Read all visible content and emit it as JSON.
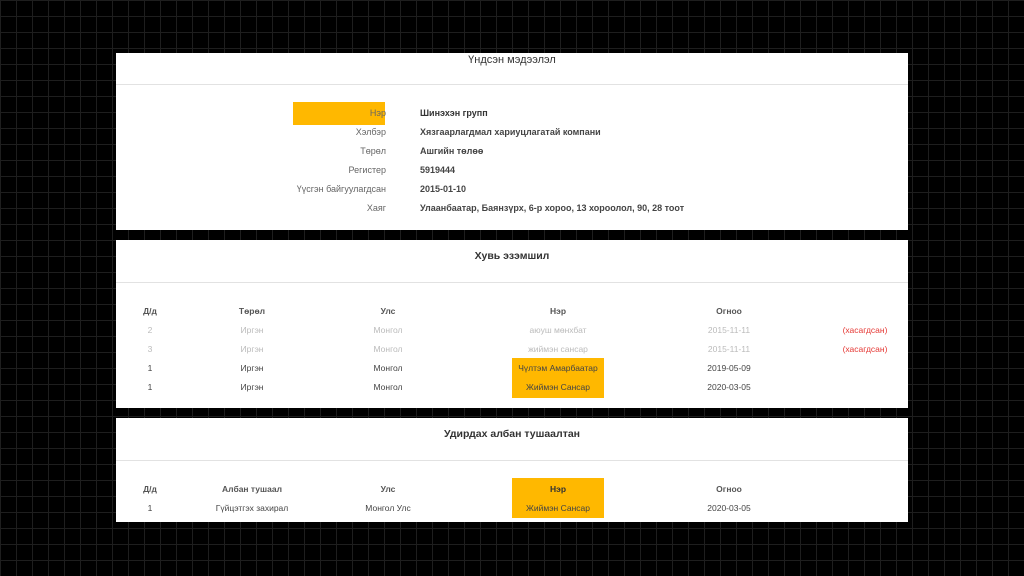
{
  "basic": {
    "title": "Үндсэн мэдээлэл",
    "rows": [
      {
        "label": "Нэр",
        "value": "Шинэхэн групп"
      },
      {
        "label": "Хэлбэр",
        "value": "Хязгаарлагдмал хариуцлагатай компани"
      },
      {
        "label": "Төрөл",
        "value": "Ашгийн төлөө"
      },
      {
        "label": "Регистер",
        "value": "5919444"
      },
      {
        "label": "Үүсгэн байгуулагдсан",
        "value": "2015-01-10"
      },
      {
        "label": "Хаяг",
        "value": "Улаанбаатар, Баянзүрх, 6-р хороо, 13 хороолол, 90, 28 тоот"
      }
    ]
  },
  "ownership": {
    "title": "Хувь эзэмшил",
    "headers": [
      "Д/д",
      "Төрөл",
      "Улс",
      "Нэр",
      "Огноо"
    ],
    "rows": [
      {
        "no": "2",
        "type": "Иргэн",
        "country": "Монгол",
        "name": "аюуш мөнхбат",
        "date": "2015-11-11",
        "status": "(хасагдсан)"
      },
      {
        "no": "3",
        "type": "Иргэн",
        "country": "Монгол",
        "name": "жиймэн сансар",
        "date": "2015-11-11",
        "status": "(хасагдсан)"
      },
      {
        "no": "1",
        "type": "Иргэн",
        "country": "Монгол",
        "name": "Чүлтэм Амарбаатар",
        "date": "2019-05-09",
        "status": ""
      },
      {
        "no": "1",
        "type": "Иргэн",
        "country": "Монгол",
        "name": "Жиймэн Сансар",
        "date": "2020-03-05",
        "status": ""
      }
    ]
  },
  "officials": {
    "title": "Удирдах албан тушаалтан",
    "headers": [
      "Д/д",
      "Албан тушаал",
      "Улс",
      "Нэр",
      "Огноо"
    ],
    "rows": [
      {
        "no": "1",
        "position": "Гүйцэтгэх захирал",
        "country": "Монгол Улс",
        "name": "Жиймэн Сансар",
        "date": "2020-03-05"
      }
    ]
  },
  "colors": {
    "highlight": "#ffb800",
    "removed": "#e53935"
  }
}
